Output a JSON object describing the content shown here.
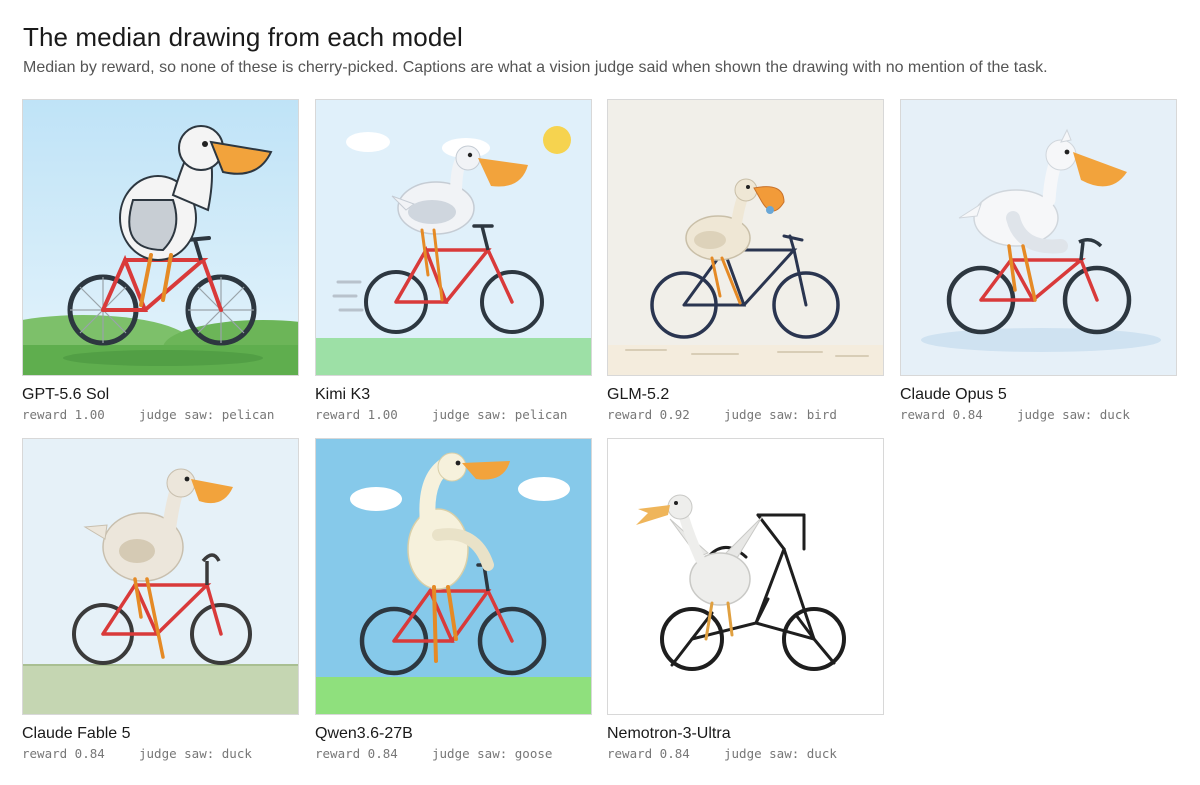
{
  "header": {
    "title": "The median drawing from each model",
    "subtitle": "Median by reward, so none of these is cherry-picked. Captions are what a vision judge said when shown the drawing with no mention of the task."
  },
  "cards": [
    {
      "model": "GPT-5.6 Sol",
      "reward": "reward 1.00",
      "judge": "judge saw: pelican"
    },
    {
      "model": "Kimi K3",
      "reward": "reward 1.00",
      "judge": "judge saw: pelican"
    },
    {
      "model": "GLM-5.2",
      "reward": "reward 0.92",
      "judge": "judge saw: bird"
    },
    {
      "model": "Claude Opus 5",
      "reward": "reward 0.84",
      "judge": "judge saw: duck"
    },
    {
      "model": "Claude Fable 5",
      "reward": "reward 0.84",
      "judge": "judge saw: duck"
    },
    {
      "model": "Qwen3.6-27B",
      "reward": "reward 0.84",
      "judge": "judge saw: goose"
    },
    {
      "model": "Nemotron-3-Ultra",
      "reward": "reward 0.84",
      "judge": "judge saw: duck"
    }
  ]
}
